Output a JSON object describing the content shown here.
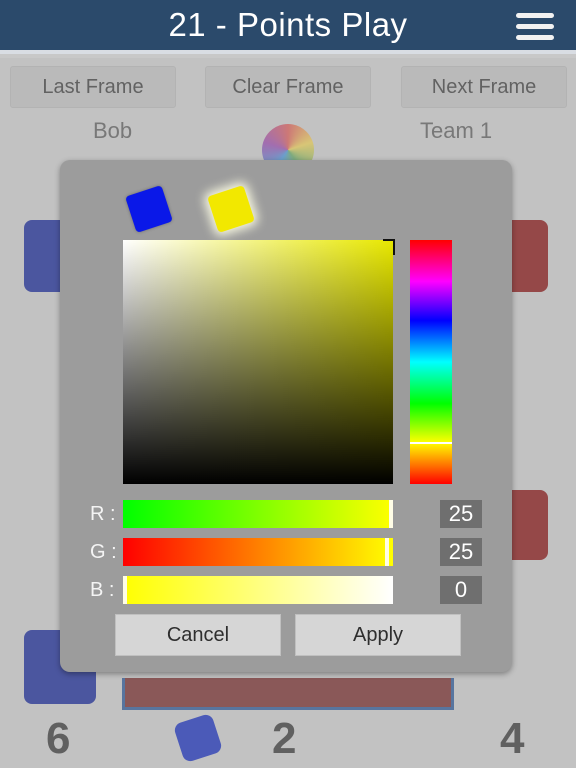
{
  "header": {
    "title": "21 - Points Play",
    "menu_icon": "hamburger-menu-icon"
  },
  "frame_nav": {
    "last": "Last Frame",
    "clear": "Clear Frame",
    "next": "Next Frame"
  },
  "players": {
    "left_name": "Bob",
    "right_name": "Team 1"
  },
  "scores": {
    "left": "6",
    "center": "2",
    "right": "4"
  },
  "color_picker": {
    "swatches": [
      {
        "name": "blue",
        "color": "#0a18e8"
      },
      {
        "name": "yellow",
        "color": "#f2e800",
        "selected": true
      }
    ],
    "sliders": [
      {
        "label": "R :",
        "value": "25"
      },
      {
        "label": "G :",
        "value": "25"
      },
      {
        "label": "B :",
        "value": "0"
      }
    ],
    "cancel_label": "Cancel",
    "apply_label": "Apply"
  },
  "colors": {
    "header_bg": "#2b4a6b",
    "dialog_bg": "#9c9c9c",
    "team_blue": "#1a2a9a",
    "team_red": "#8a1414"
  }
}
